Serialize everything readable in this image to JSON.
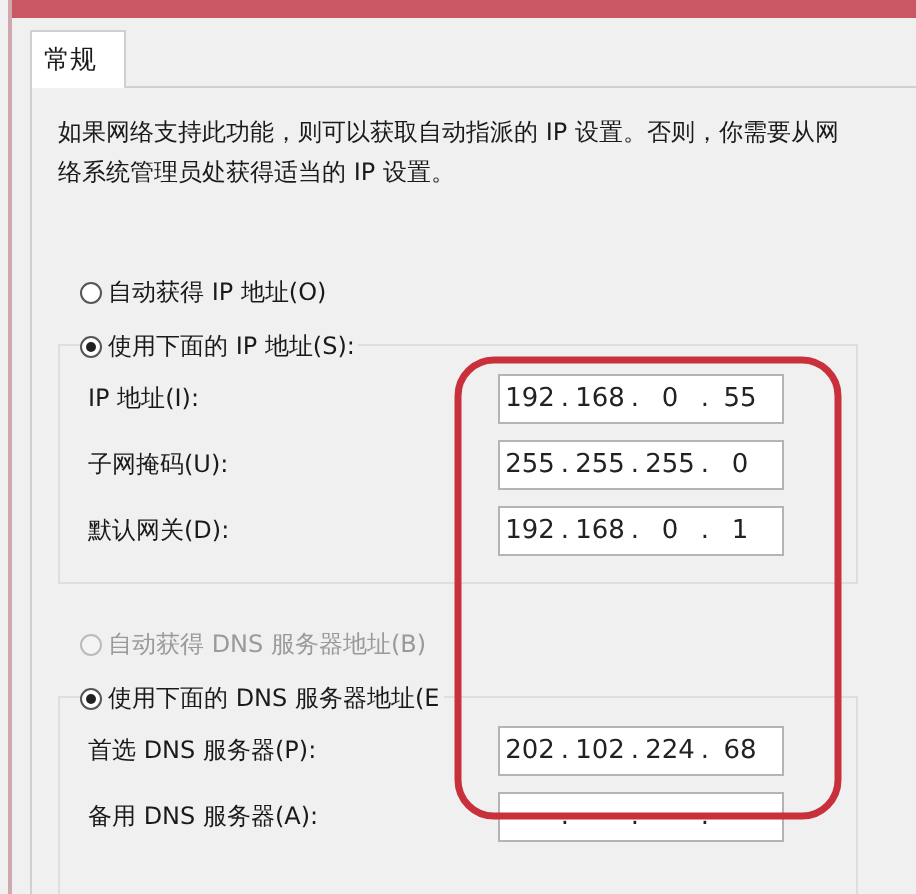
{
  "tabs": [
    {
      "label": "常规",
      "selected": true
    }
  ],
  "description": [
    "如果网络支持此功能，则可以获取自动指派的 IP 设置。否则，你需要从网",
    "络系统管理员处获得适当的 IP 设置。"
  ],
  "ip_section": {
    "auto_option": {
      "label": "自动获得 IP 地址(O)",
      "selected": false,
      "disabled": false
    },
    "manual_option": {
      "label": "使用下面的 IP 地址(S):",
      "selected": true,
      "disabled": false
    },
    "fields": [
      {
        "label": "IP 地址(I):",
        "octets": [
          "192",
          "168",
          "0",
          "55"
        ],
        "separator": "."
      },
      {
        "label": "子网掩码(U):",
        "octets": [
          "255",
          "255",
          "255",
          "0"
        ],
        "separator": "."
      },
      {
        "label": "默认网关(D):",
        "octets": [
          "192",
          "168",
          "0",
          "1"
        ],
        "separator": "."
      }
    ]
  },
  "dns_section": {
    "auto_option": {
      "label": "自动获得 DNS 服务器地址(B)",
      "selected": false,
      "disabled": true
    },
    "manual_option": {
      "label": "使用下面的 DNS 服务器地址(E",
      "selected": true,
      "disabled": false
    },
    "fields": [
      {
        "label": "首选 DNS 服务器(P):",
        "octets": [
          "202",
          "102",
          "224",
          "68"
        ],
        "separator": "."
      },
      {
        "label": "备用 DNS 服务器(A):",
        "separator": "."
      }
    ]
  },
  "annotation": {
    "kind": "rounded-outline",
    "color": "#c8313b"
  }
}
